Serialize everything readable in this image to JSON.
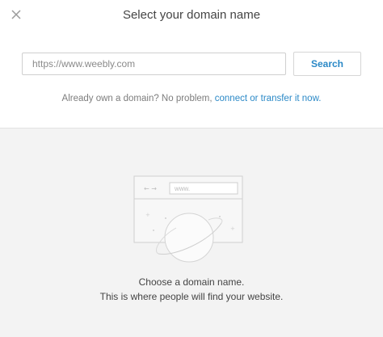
{
  "header": {
    "title": "Select your domain name",
    "close_icon": "close-icon"
  },
  "search": {
    "placeholder": "https://www.weebly.com",
    "value": "",
    "button_label": "Search"
  },
  "help": {
    "text": "Already own a domain? No problem, ",
    "link_label": "connect or transfer it now."
  },
  "illustration": {
    "url_bar_text": "www.",
    "icons": [
      "browser-window-icon",
      "planet-icon"
    ]
  },
  "empty_state": {
    "line1": "Choose a domain name.",
    "line2": "This is where people will find your website."
  },
  "colors": {
    "accent": "#2b89c7",
    "panel_background": "#f3f3f3",
    "header_background": "#ffffff"
  }
}
